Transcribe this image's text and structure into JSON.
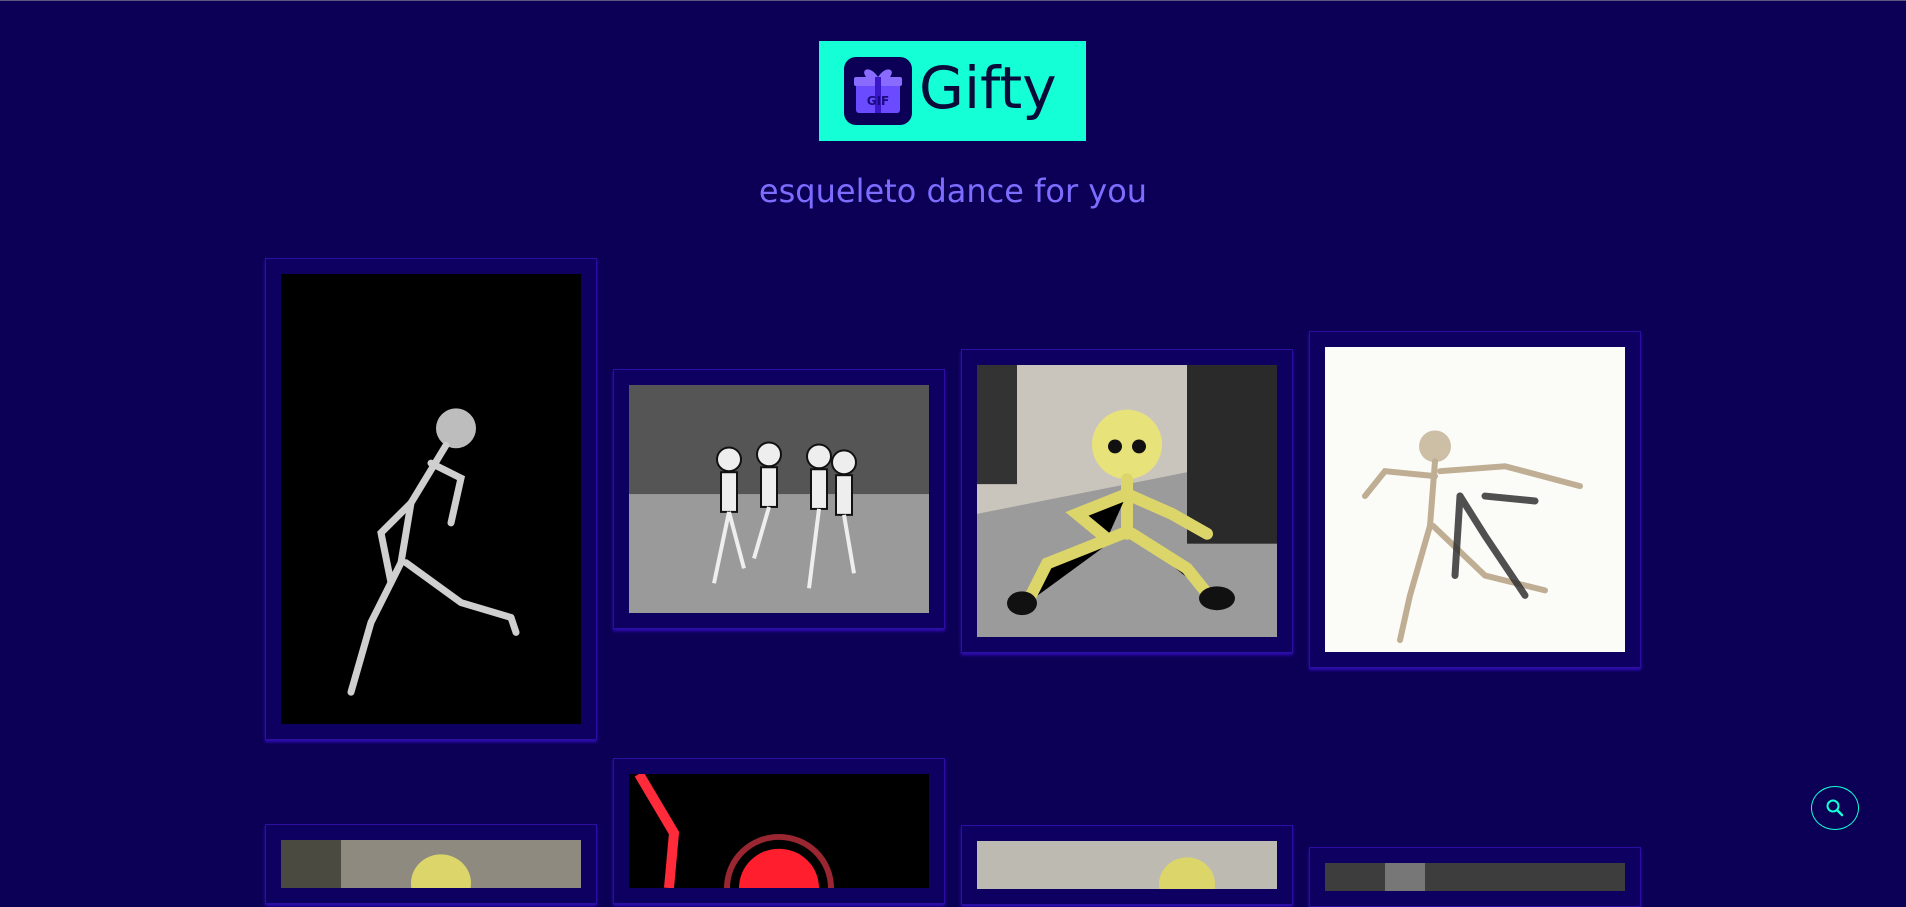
{
  "header": {
    "logo_text": "Gifty",
    "logo_badge_text": "GIF",
    "subtitle": "esqueleto dance for you"
  },
  "colors": {
    "background": "#0b0056",
    "logo_bg": "#15ffd6",
    "subtitle": "#7d6dff",
    "card_border": "#2c0ea0",
    "accent": "#15ffd6"
  },
  "gifs": [
    {
      "subject": "skeleton dancing on black"
    },
    {
      "subject": "cartoon skeletons dancing in graveyard"
    },
    {
      "subject": "yellow toy skeleton dancing"
    },
    {
      "subject": "3d skeleton dancing on white"
    },
    {
      "subject": "skeleton partial"
    },
    {
      "subject": "red glowing skeleton"
    },
    {
      "subject": "yellow skeleton partial"
    },
    {
      "subject": "skeleton partial grey"
    }
  ],
  "search_button": {
    "icon": "search-icon"
  }
}
